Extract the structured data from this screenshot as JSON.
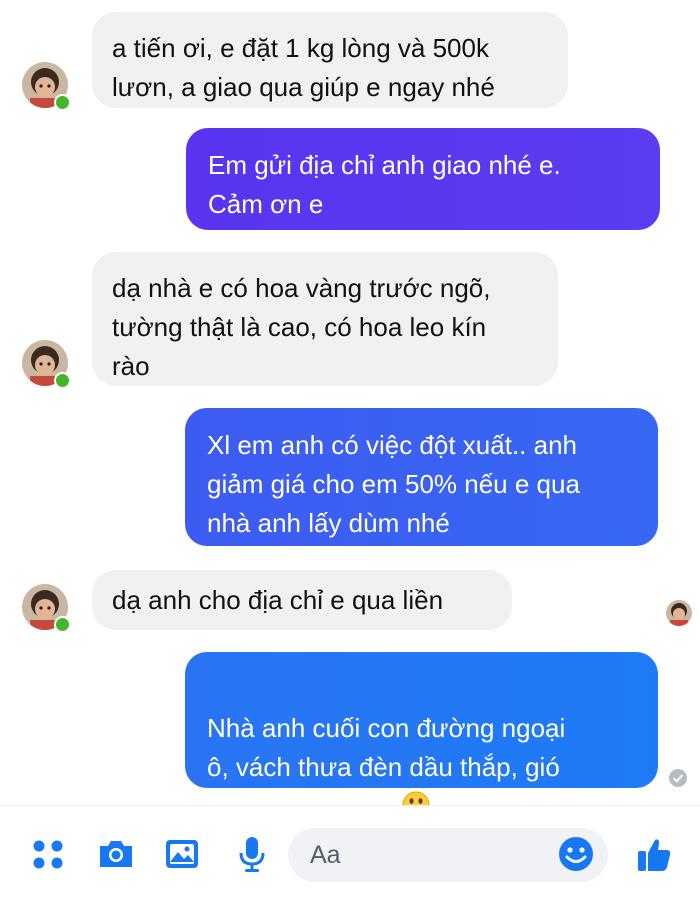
{
  "messages": [
    {
      "side": "in",
      "text": "a tiến ơi, e đặt 1 kg lòng và 500k\nlươn, a giao qua giúp e ngay nhé"
    },
    {
      "side": "out",
      "text": "Em gửi địa chỉ anh giao nhé e.\nCảm ơn e"
    },
    {
      "side": "in",
      "text": "dạ nhà e có hoa vàng trước ngõ,\ntường thật là cao, có hoa leo kín\nrào"
    },
    {
      "side": "out",
      "text": "Xl em anh có việc đột xuất.. anh\ngiảm giá cho em 50% nếu e qua\nnhà anh lấy dùm nhé"
    },
    {
      "side": "in",
      "text": "dạ anh cho địa chỉ e qua liền"
    },
    {
      "side": "out",
      "text": "Nhà anh cuối con đường ngoại\nô, vách thưa đèn dầu thắp, gió\nlùa vào từng căn"
    }
  ],
  "composer": {
    "placeholder": "Aa",
    "icons": [
      "menu-dots-icon",
      "camera-icon",
      "gallery-icon",
      "microphone-icon",
      "emoji-icon",
      "thumbs-up-icon"
    ]
  },
  "colors": {
    "incoming_bubble": "#f1f0f3",
    "outgoing_gradient": [
      "#6236f0",
      "#4b4ef1",
      "#2f6cf3",
      "#1b7ef6"
    ],
    "accent": "#1877f2",
    "online": "#42b72a"
  }
}
